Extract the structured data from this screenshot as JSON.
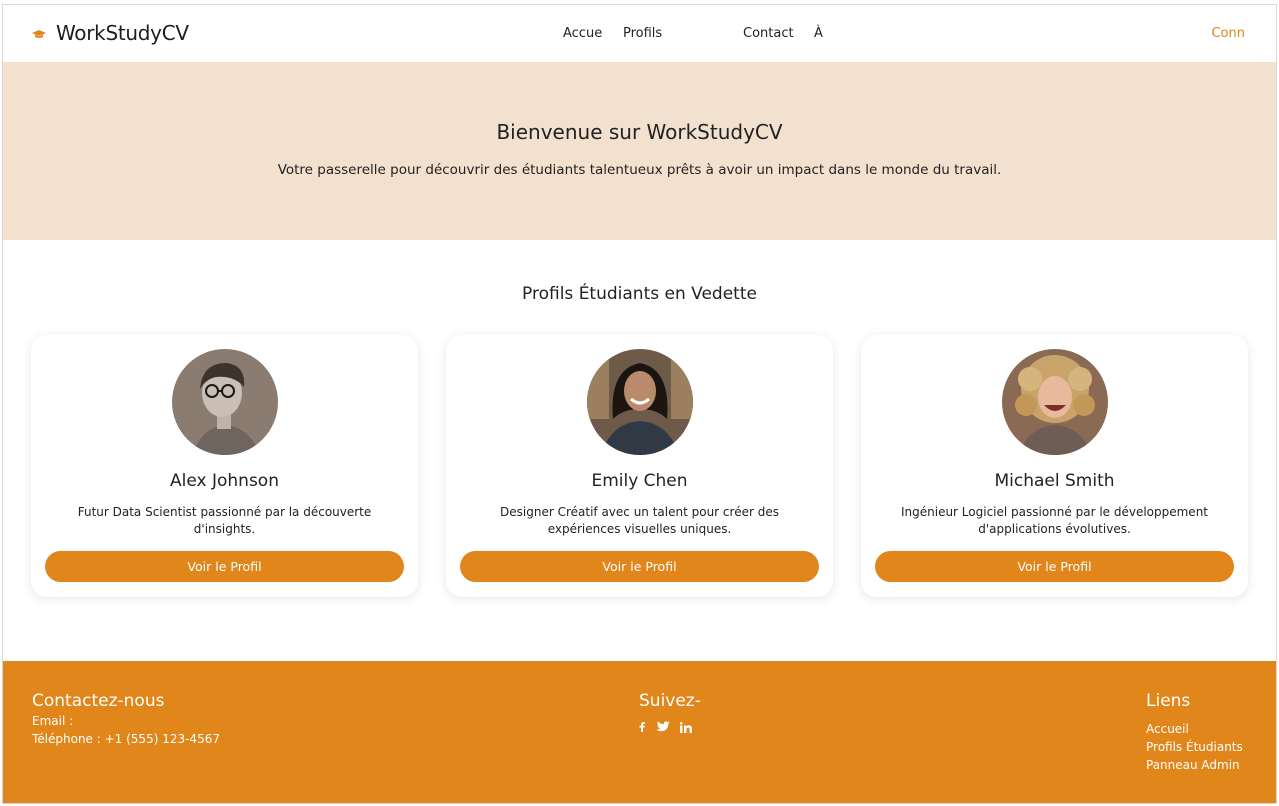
{
  "header": {
    "brand": "WorkStudyCV",
    "nav": [
      "Accue",
      "Profils",
      "Contact",
      "À"
    ],
    "login": "Conn"
  },
  "hero": {
    "title": "Bienvenue sur WorkStudyCV",
    "subtitle": "Votre passerelle pour découvrir des étudiants talentueux prêts à avoir un impact dans le monde du travail."
  },
  "featured": {
    "title": "Profils Étudiants en Vedette",
    "profiles": [
      {
        "name": "Alex Johnson",
        "description": "Futur Data Scientist passionné par la découverte d'insights.",
        "button": "Voir le Profil"
      },
      {
        "name": "Emily Chen",
        "description": "Designer Créatif avec un talent pour créer des expériences visuelles uniques.",
        "button": "Voir le Profil"
      },
      {
        "name": "Michael Smith",
        "description": "Ingénieur Logiciel passionné par le développement d'applications évolutives.",
        "button": "Voir le Profil"
      }
    ]
  },
  "footer": {
    "contact": {
      "title": "Contactez-nous",
      "email": "Email :",
      "phone": "Téléphone : +1 (555) 123-4567"
    },
    "follow": {
      "title": "Suivez-",
      "icons": [
        "facebook-icon",
        "twitter-icon",
        "linkedin-icon"
      ]
    },
    "links": {
      "title": "Liens",
      "items": [
        "Accueil",
        "Profils Étudiants",
        "Panneau Admin"
      ]
    }
  },
  "colors": {
    "accent": "#e0861b",
    "hero_bg": "#f2e1cf"
  }
}
